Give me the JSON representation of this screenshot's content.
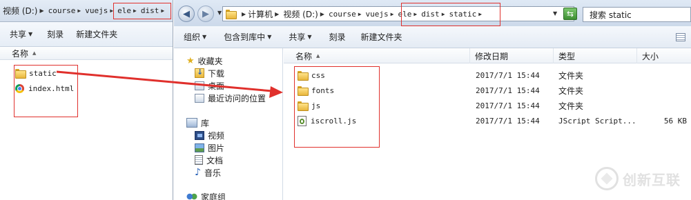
{
  "left_window": {
    "breadcrumb": [
      "视频 (D:)",
      "course",
      "vuejs",
      "ele",
      "dist"
    ],
    "toolbar": [
      "共享",
      "刻录",
      "新建文件夹"
    ],
    "column_name": "名称",
    "items": [
      {
        "name": "static",
        "icon": "folder-icon"
      },
      {
        "name": "index.html",
        "icon": "chrome-file-icon"
      }
    ]
  },
  "right_window": {
    "breadcrumb": [
      "计算机",
      "视频 (D:)",
      "course",
      "vuejs",
      "ele",
      "dist",
      "static"
    ],
    "search_placeholder": "搜索 static",
    "toolbar": [
      "组织",
      "包含到库中",
      "共享",
      "刻录",
      "新建文件夹"
    ],
    "nav": {
      "favorites": "收藏夹",
      "favorite_items": [
        "下载",
        "桌面",
        "最近访问的位置"
      ],
      "libraries": "库",
      "library_items": [
        "视频",
        "图片",
        "文档",
        "音乐"
      ],
      "homegroup": "家庭组"
    },
    "columns": [
      "名称",
      "修改日期",
      "类型",
      "大小"
    ],
    "files": [
      {
        "name": "css",
        "date": "2017/7/1 15:44",
        "type": "文件夹",
        "size": ""
      },
      {
        "name": "fonts",
        "date": "2017/7/1 15:44",
        "type": "文件夹",
        "size": ""
      },
      {
        "name": "js",
        "date": "2017/7/1 15:44",
        "type": "文件夹",
        "size": ""
      },
      {
        "name": "iscroll.js",
        "date": "2017/7/1 15:44",
        "type": "JScript Script...",
        "size": "56 KB"
      }
    ]
  },
  "annotation_color": "#e0302c",
  "watermark": "创新互联"
}
